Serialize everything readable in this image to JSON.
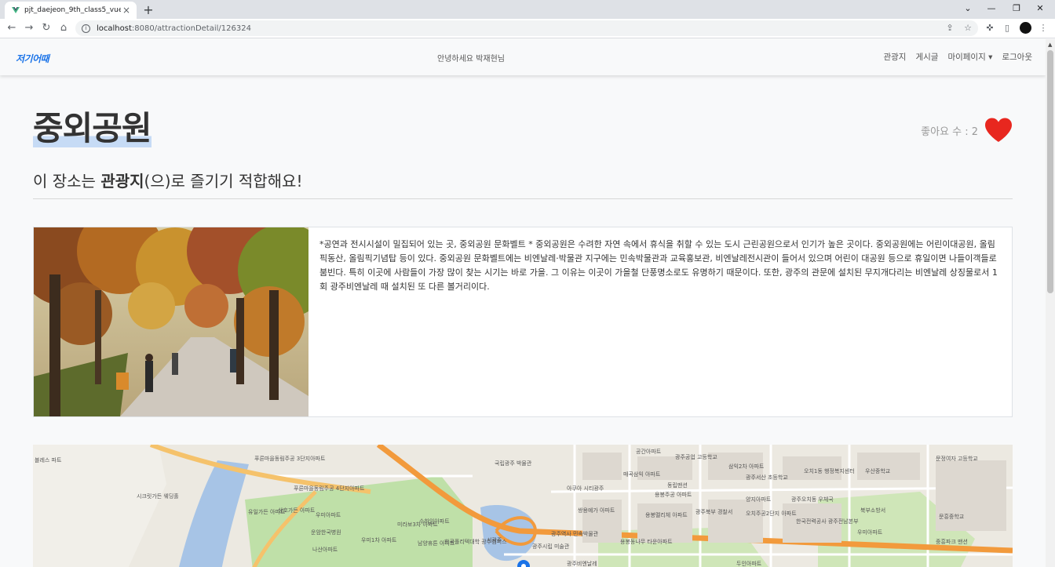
{
  "browser": {
    "tab_title": "pjt_daejeon_9th_class5_vue_team",
    "tab_close": "×",
    "new_tab": "+",
    "url_host": "localhost",
    "url_path": ":8080/attractionDetail/126324"
  },
  "navbar": {
    "brand": "저기어때",
    "greeting": "안녕하세요 박재현님",
    "links": [
      "관광지",
      "게시글",
      "마이페이지 ▾",
      "로그아웃"
    ]
  },
  "place": {
    "title": "중외공원",
    "likes_label": "좋아요 수 : 2",
    "subtitle_pre": "이 장소는 ",
    "subtitle_category": "관광지",
    "subtitle_post": "(으)로 즐기기 적합해요!",
    "description": "*공연과 전시시설이 밀집되어 있는 곳, 중외공원 문화벨트 * 중외공원은 수려한 자연 속에서 휴식을 취할 수 있는 도시 근린공원으로서 인기가 높은 곳이다. 중외공원에는 어린이대공원, 올림픽동산, 올림픽기념탑 등이 있다. 중외공원 문화벨트에는 비엔날레·박물관 지구에는 민속박물관과 교육홍보관, 비엔날레전시관이 들어서 있으며 어린이 대공원 등으로 휴일이면 나들이객들로 붐빈다. 특히 이곳에 사람들이 가장 많이 찾는 시기는 바로 가을. 그 이유는 이곳이 가을철 단풍명소로도 유명하기 때문이다. 또한, 광주의 관문에 설치된 무지개다리는 비엔날레 상징물로서 1회 광주비엔날레 때 설치된 또 다른 볼거리이다."
  },
  "map": {
    "labels": [
      "블레스 파트",
      "푸른마을동림주공 3단지아파트",
      "국립광주 박물관",
      "공간아파트",
      "광주공업 고등학교",
      "삼익2차 아파트",
      "오치1동 행정복지센터",
      "우산중학교",
      "문정여자 고등학교",
      "시크릿가든 웨딩홀",
      "푸른마을동림주공 4단지아파트",
      "매곡삼익 아파트",
      "동립맨션",
      "광주서산 초등학교",
      "아쿠아 시티광주",
      "용봉주공 아파트",
      "양지아파트",
      "광주오치동 우체국",
      "북부소방서",
      "유일가든 아파트",
      "상호가든 아파트",
      "우미아파트",
      "수하임아파트",
      "쌍용예가 아파트",
      "용봉멜리체 아파트",
      "광주북부 경찰서",
      "오치주공2단지 아파트",
      "한국전력공사 광주전남본부",
      "문흥중학교",
      "운암한국병원",
      "미라보3차 아파트",
      "서광주",
      "광주역사 민속박물관",
      "용봉동나무 타운아파트",
      "우미아파트",
      "중흥파크 맨션",
      "나산아파트",
      "남양휴튼 아파트",
      "한국폴리텍대학 광주캠퍼스",
      "광주시립 미술관",
      "광주비엔날레",
      "두인아파트",
      "우미1차 아파트"
    ]
  },
  "colors": {
    "brand": "#1a73e8",
    "heart": "#e8271f",
    "title_highlight": "#c6dbf5"
  }
}
